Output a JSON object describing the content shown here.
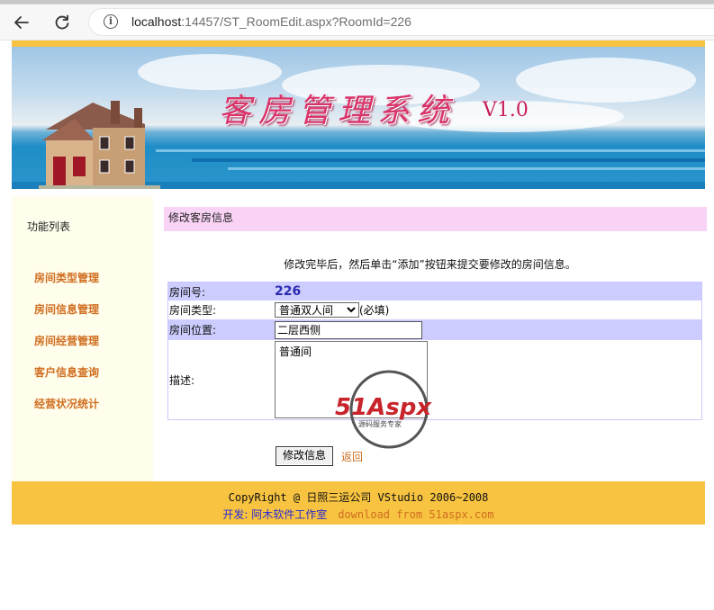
{
  "browser": {
    "url_host": "localhost",
    "url_rest": ":14457/ST_RoomEdit.aspx?RoomId=226"
  },
  "banner": {
    "title": "客房管理系统",
    "version": "V1.0"
  },
  "sidebar": {
    "title": "功能列表",
    "items": [
      {
        "label": "房间类型管理"
      },
      {
        "label": "房间信息管理"
      },
      {
        "label": "房间经营管理"
      },
      {
        "label": "客户信息查询"
      },
      {
        "label": "经营状况统计"
      }
    ]
  },
  "main": {
    "panel_title": "修改客房信息",
    "hint": "修改完毕后，然后单击“添加”按钮来提交要修改的房间信息。",
    "form": {
      "room_no_label": "房间号:",
      "room_no_value": "226",
      "type_label": "房间类型:",
      "type_value": "普通双人间",
      "type_required": "(必填)",
      "location_label": "房间位置:",
      "location_value": "二层西侧",
      "description_label": "描述:",
      "description_value": "普通间"
    },
    "watermark": {
      "brand": "51Aspx",
      "tagline": "源码服务专家"
    },
    "submit_label": "修改信息",
    "back_label": "返回"
  },
  "footer": {
    "copyright": "CopyRight @ 日照三运公司 VStudio 2006~2008",
    "developer": "开发: 阿木软件工作室",
    "download": "download from 51aspx.com"
  },
  "colors": {
    "gold": "#f7c340",
    "header_pink": "#f9d3f5",
    "row_lavender": "#ccccff",
    "link_orange": "#d06e20",
    "title_magenta": "#d9336a"
  }
}
